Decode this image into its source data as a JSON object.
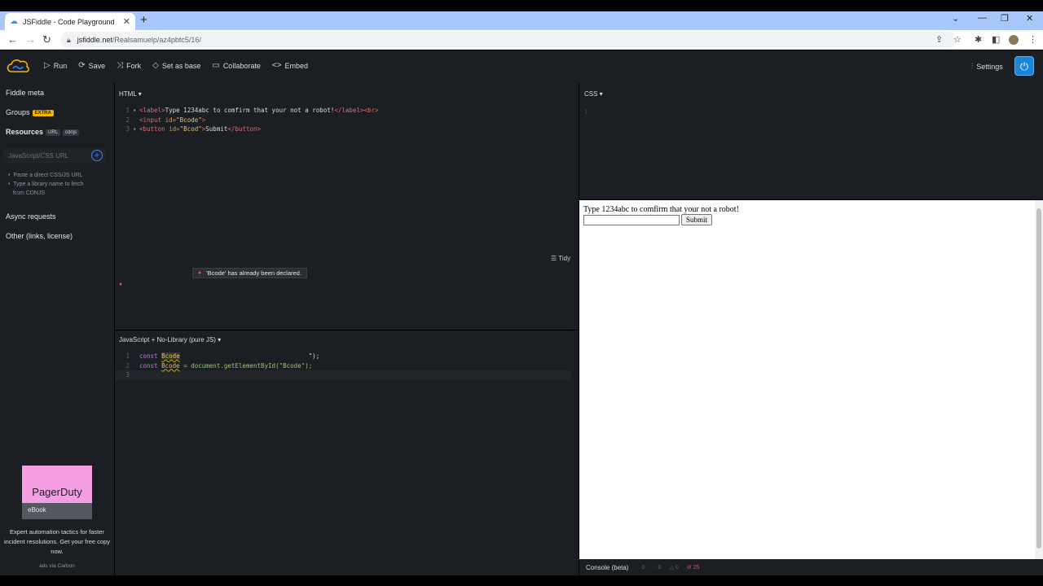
{
  "browser": {
    "tab_title": "JSFiddle - Code Playground",
    "tab_close": "✕",
    "new_tab": "+",
    "url_host": "jsfiddle.net",
    "url_path": "/Realsamuelp/az4pbtc5/16/"
  },
  "header": {
    "menu": [
      {
        "icon": "▷",
        "label": "Run"
      },
      {
        "icon": "⟳",
        "label": "Save"
      },
      {
        "icon": "⤨",
        "label": "Fork"
      },
      {
        "icon": "◇",
        "label": "Set as base"
      },
      {
        "icon": "▭",
        "label": "Collaborate"
      },
      {
        "icon": "<>",
        "label": "Embed"
      }
    ],
    "settings_label": "Settings"
  },
  "sidebar": {
    "fiddle_meta": "Fiddle meta",
    "groups": "Groups",
    "groups_badge": "EXTRA",
    "resources": "Resources",
    "resources_badge_url": "URL",
    "resources_badge_cdnjs": "cdnjs",
    "resource_placeholder": "JavaScript/CSS URL",
    "hint_1": "Paste a direct CSS/JS URL",
    "hint_2a": "Type a library name to fetch",
    "hint_2b": "from CDNJS",
    "async": "Async requests",
    "other": "Other (links, license)",
    "ad_brand": "PagerDuty",
    "ad_caption": "eBook",
    "ad_text": "Expert automation tactics for faster incident resolutions. Get your free copy now.",
    "ad_via": "ads via Carbon"
  },
  "html_panel": {
    "label": "HTML ▾",
    "lines": [
      "1",
      "2",
      "3"
    ],
    "l1_text": "Type 1234abc to comfirm that your not a robot!",
    "l2_attr": "id=",
    "l2_val": "\"Bcode\"",
    "l3_val": "\"Bcod\"",
    "l3_text": "Submit"
  },
  "css_panel": {
    "label": "CSS ▾",
    "line": "1"
  },
  "js_panel": {
    "label": "JavaScript + No-Library (pure JS) ▾",
    "tidy": "Tidy",
    "tooltip": "'Bcode' has already been declared.",
    "l1_kw": "const",
    "l1_var": "Bcode",
    "l1_tail": "\");",
    "l2_kw": "const",
    "l2_var": "Bcode",
    "l2_tail": " = document.getElementById(\"Bcode\");",
    "lines": [
      "1",
      "2",
      "3"
    ]
  },
  "result": {
    "label": "Type 1234abc to comfirm that your not a robot!",
    "button": "Submit"
  },
  "console": {
    "label": "Console (beta)",
    "c1": "0",
    "c2": "0",
    "c3": "0",
    "errors": "25"
  }
}
